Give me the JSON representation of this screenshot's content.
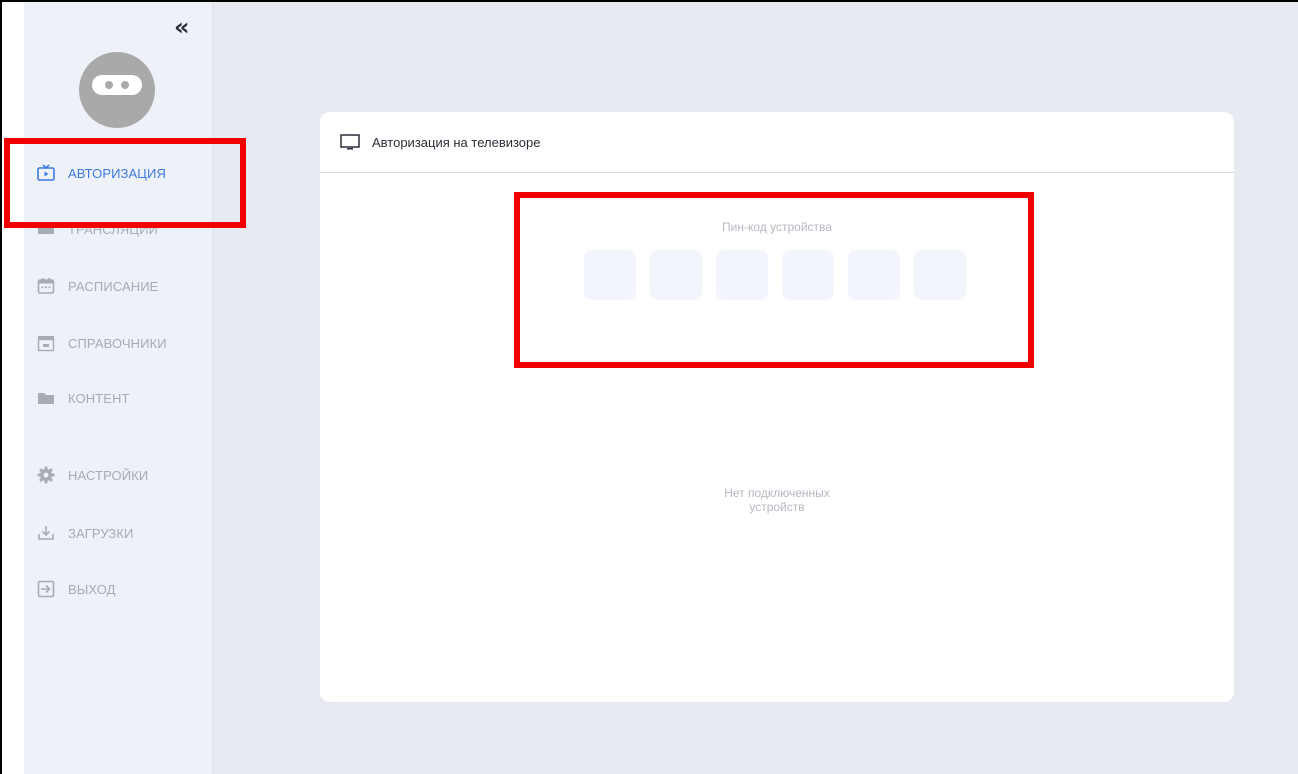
{
  "sidebar": {
    "collapse_glyph": "«",
    "items": [
      {
        "label": "АВТОРИЗАЦИЯ",
        "icon": "tv-play-icon",
        "active": true
      },
      {
        "label": "ТРАНСЛЯЦИИ",
        "icon": "broadcast-icon",
        "active": false
      },
      {
        "label": "РАСПИСАНИЕ",
        "icon": "calendar-icon",
        "active": false
      },
      {
        "label": "СПРАВОЧНИКИ",
        "icon": "directory-icon",
        "active": false
      },
      {
        "label": "КОНТЕНТ",
        "icon": "folder-icon",
        "active": false
      },
      {
        "label": "НАСТРОЙКИ",
        "icon": "gear-icon",
        "active": false
      },
      {
        "label": "ЗАГРУЗКИ",
        "icon": "download-icon",
        "active": false
      },
      {
        "label": "ВЫХОД",
        "icon": "logout-icon",
        "active": false
      }
    ]
  },
  "card": {
    "title": "Авторизация на телевизоре",
    "pin_label": "Пин-код устройства",
    "pin_values": [
      "",
      "",
      "",
      "",
      "",
      ""
    ],
    "empty_line1": "Нет подключенных",
    "empty_line2": "устройств"
  },
  "colors": {
    "accent": "#3b7be3",
    "highlight": "#f20000",
    "sidebar_bg": "#eef1f7",
    "main_bg": "#e8eaf2"
  }
}
